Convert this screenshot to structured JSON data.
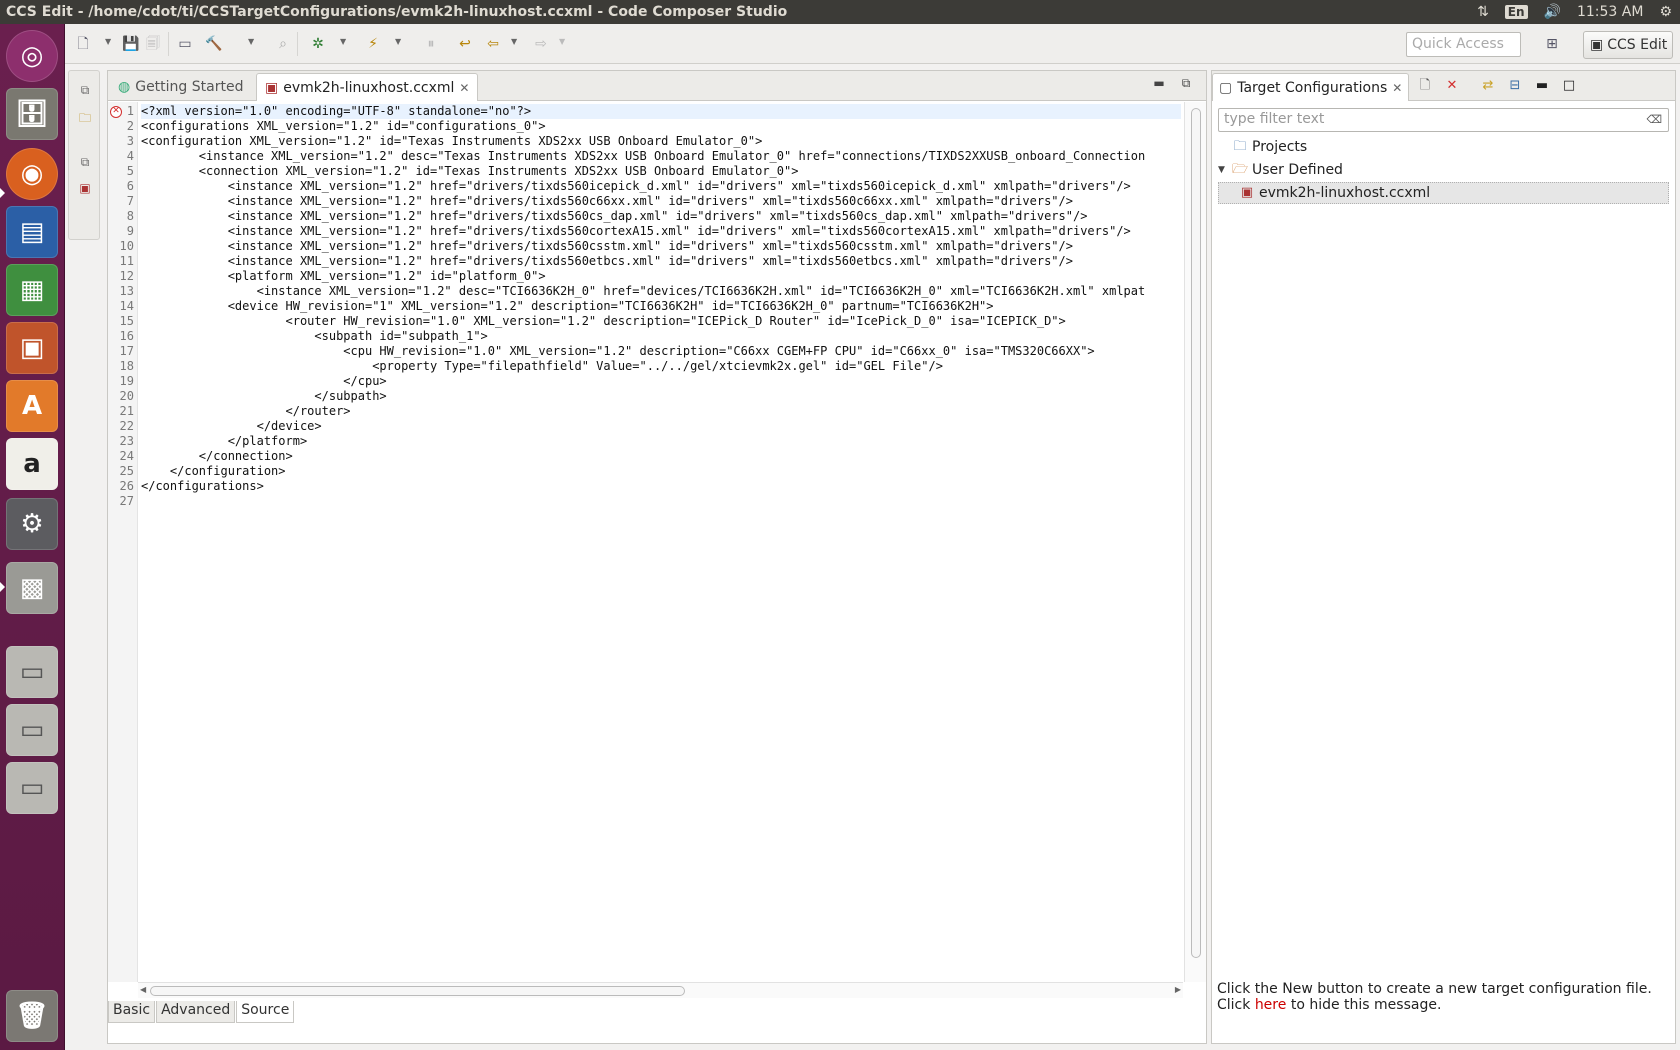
{
  "topbar": {
    "title": "CCS Edit - /home/cdot/ti/CCSTargetConfigurations/evmk2h-linuxhost.ccxml - Code Composer Studio",
    "lang": "En",
    "time": "11:53 AM"
  },
  "launcher": {
    "items": [
      "ubuntu-dash",
      "files",
      "firefox",
      "writer",
      "calc",
      "impress",
      "software-center",
      "amazon",
      "system-settings",
      "code-composer",
      "drive-1",
      "drive-2",
      "drive-3",
      "trash"
    ]
  },
  "toolbar": {
    "quick_access_placeholder": "Quick Access",
    "perspective_label": "CCS Edit"
  },
  "editor": {
    "tabs": [
      {
        "label": "Getting Started"
      },
      {
        "label": "evmk2h-linuxhost.ccxml"
      }
    ],
    "lines": [
      "<?xml version=\"1.0\" encoding=\"UTF-8\" standalone=\"no\"?>",
      "<configurations XML_version=\"1.2\" id=\"configurations_0\">",
      "<configuration XML_version=\"1.2\" id=\"Texas Instruments XDS2xx USB Onboard Emulator_0\">",
      "        <instance XML_version=\"1.2\" desc=\"Texas Instruments XDS2xx USB Onboard Emulator_0\" href=\"connections/TIXDS2XXUSB_onboard_Connection",
      "        <connection XML_version=\"1.2\" id=\"Texas Instruments XDS2xx USB Onboard Emulator_0\">",
      "            <instance XML_version=\"1.2\" href=\"drivers/tixds560icepick_d.xml\" id=\"drivers\" xml=\"tixds560icepick_d.xml\" xmlpath=\"drivers\"/>",
      "            <instance XML_version=\"1.2\" href=\"drivers/tixds560c66xx.xml\" id=\"drivers\" xml=\"tixds560c66xx.xml\" xmlpath=\"drivers\"/>",
      "            <instance XML_version=\"1.2\" href=\"drivers/tixds560cs_dap.xml\" id=\"drivers\" xml=\"tixds560cs_dap.xml\" xmlpath=\"drivers\"/>",
      "            <instance XML_version=\"1.2\" href=\"drivers/tixds560cortexA15.xml\" id=\"drivers\" xml=\"tixds560cortexA15.xml\" xmlpath=\"drivers\"/>",
      "            <instance XML_version=\"1.2\" href=\"drivers/tixds560csstm.xml\" id=\"drivers\" xml=\"tixds560csstm.xml\" xmlpath=\"drivers\"/>",
      "            <instance XML_version=\"1.2\" href=\"drivers/tixds560etbcs.xml\" id=\"drivers\" xml=\"tixds560etbcs.xml\" xmlpath=\"drivers\"/>",
      "            <platform XML_version=\"1.2\" id=\"platform_0\">",
      "                <instance XML_version=\"1.2\" desc=\"TCI6636K2H_0\" href=\"devices/TCI6636K2H.xml\" id=\"TCI6636K2H_0\" xml=\"TCI6636K2H.xml\" xmlpat",
      "            <device HW_revision=\"1\" XML_version=\"1.2\" description=\"TCI6636K2H\" id=\"TCI6636K2H_0\" partnum=\"TCI6636K2H\">",
      "                    <router HW_revision=\"1.0\" XML_version=\"1.2\" description=\"ICEPick_D Router\" id=\"IcePick_D_0\" isa=\"ICEPICK_D\">",
      "                        <subpath id=\"subpath_1\">",
      "                            <cpu HW_revision=\"1.0\" XML_version=\"1.2\" description=\"C66xx CGEM+FP CPU\" id=\"C66xx_0\" isa=\"TMS320C66XX\">",
      "                                <property Type=\"filepathfield\" Value=\"../../gel/xtcievmk2x.gel\" id=\"GEL File\"/>",
      "                            </cpu>",
      "                        </subpath>",
      "                    </router>",
      "                </device>",
      "            </platform>",
      "        </connection>",
      "    </configuration>",
      "</configurations>",
      ""
    ],
    "bottom_tabs": [
      "Basic",
      "Advanced",
      "Source"
    ]
  },
  "target_view": {
    "tab_label": "Target Configurations",
    "filter_placeholder": "type filter text",
    "tree": {
      "projects": "Projects",
      "user_defined": "User Defined",
      "file": "evmk2h-linuxhost.ccxml"
    },
    "hint_pre": "Click the New button to create a new target configuration file. Click ",
    "hint_link": "here",
    "hint_post": " to hide this message."
  }
}
